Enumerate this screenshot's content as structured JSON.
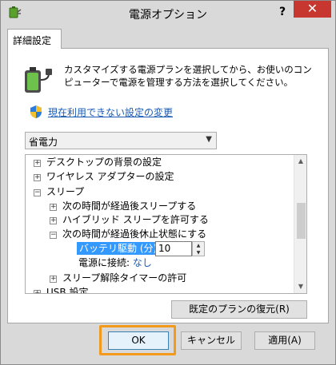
{
  "window": {
    "title": "電源オプション",
    "help": "?",
    "close": "✕"
  },
  "tab": {
    "label": "詳細設定"
  },
  "description": "カスタマイズする電源プランを選択してから、お使いのコンピューターで電源を管理する方法を選択してください。",
  "change_link": "現在利用できない設定の変更",
  "plan_select": {
    "value": "省電力"
  },
  "tree": {
    "items": [
      {
        "label": "デスクトップの背景の設定",
        "state": "collapsed"
      },
      {
        "label": "ワイヤレス アダプターの設定",
        "state": "collapsed"
      },
      {
        "label": "スリープ",
        "state": "expanded"
      },
      {
        "label": "次の時間が経過後スリープする",
        "state": "collapsed"
      },
      {
        "label": "ハイブリッド スリープを許可する",
        "state": "collapsed"
      },
      {
        "label": "次の時間が経過後休止状態にする",
        "state": "expanded"
      },
      {
        "label": "スリープ解除タイマーの許可",
        "state": "collapsed"
      },
      {
        "label": "USB 設定",
        "state": "collapsed"
      }
    ],
    "battery_label": "バッテリ駆動 (分):",
    "battery_value": "10",
    "ac_label": "電源に接続:",
    "ac_value": "なし"
  },
  "buttons": {
    "restore": "既定のプランの復元(R)",
    "ok": "OK",
    "cancel": "キャンセル",
    "apply": "適用(A)"
  },
  "colors": {
    "accent": "#3399ff",
    "link": "#1a5bb5",
    "close": "#c7372f",
    "focus": "#f39a1d"
  },
  "icons": [
    "power-plan-icon",
    "battery-plug-icon",
    "uac-shield-icon",
    "chevron-down-icon",
    "plus-icon",
    "minus-icon",
    "arrow-up-icon",
    "arrow-down-icon"
  ]
}
